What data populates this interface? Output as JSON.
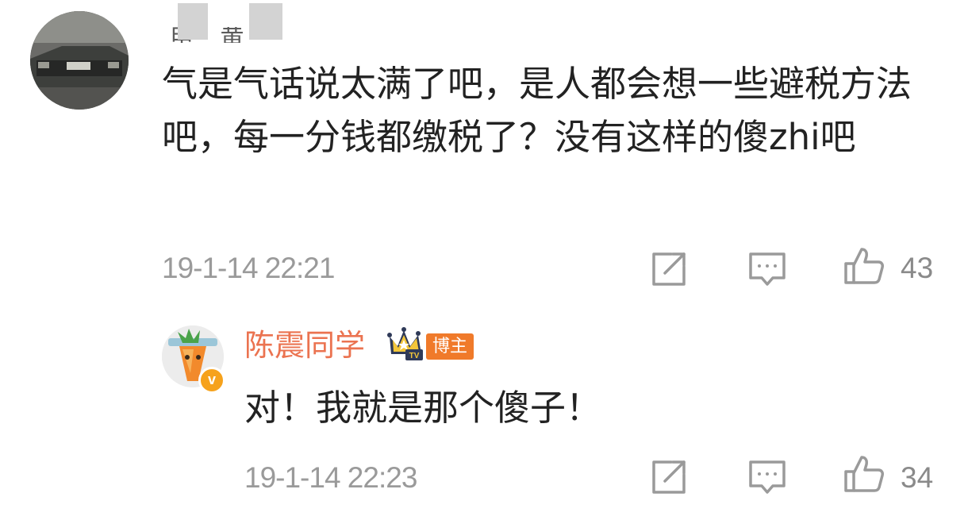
{
  "comment": {
    "username_visible": "甲 黄",
    "text": "气是气话说太满了吧，是人都会想一些避税方法吧，每一分钱都缴税了？没有这样的傻zhi吧",
    "timestamp": "19-1-14 22:21",
    "likes": "43",
    "icons": [
      "share-icon",
      "comment-icon",
      "like-icon"
    ]
  },
  "reply": {
    "username": "陈震同学",
    "badge": "博主",
    "crown_label": "TV",
    "verified_mark": "v",
    "text": "对！我就是那个傻子！",
    "timestamp": "19-1-14 22:23",
    "likes": "34",
    "icons": [
      "share-icon",
      "comment-icon",
      "like-icon"
    ]
  },
  "colors": {
    "username_accent": "#eb7350",
    "badge_bg": "#f07a2a",
    "verified_bg": "#f6a21c",
    "meta_gray": "#9a9a9a"
  }
}
